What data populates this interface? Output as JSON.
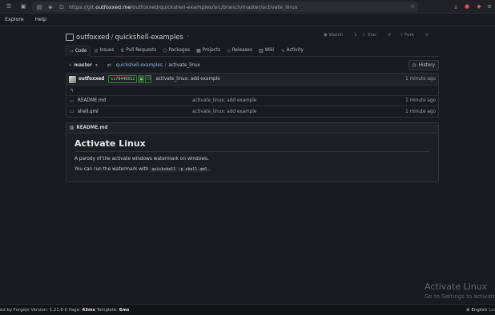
{
  "browser": {
    "url_prefix": "https://git.",
    "url_host": "outfoxxed.me",
    "url_path": "/outfoxxed/quickshell-examples/src/branch/master/activate_linux"
  },
  "topnav": {
    "explore": "Explore",
    "help": "Help"
  },
  "repo": {
    "owner": "outfoxxed",
    "separator": "/",
    "name": "quickshell-examples",
    "watch_label": "Watch",
    "watch_count": "1",
    "star_label": "Star",
    "star_count": "0",
    "fork_label": "Fork",
    "fork_count": "0"
  },
  "tabs": [
    {
      "label": "Code",
      "icon": "code-icon"
    },
    {
      "label": "Issues",
      "icon": "issue-icon"
    },
    {
      "label": "Pull Requests",
      "icon": "pull-request-icon"
    },
    {
      "label": "Packages",
      "icon": "package-icon"
    },
    {
      "label": "Projects",
      "icon": "project-icon"
    },
    {
      "label": "Releases",
      "icon": "tag-icon"
    },
    {
      "label": "Wiki",
      "icon": "book-icon"
    },
    {
      "label": "Activity",
      "icon": "pulse-icon"
    }
  ],
  "branch": {
    "name": "master",
    "crumb_repo": "quickshell-examples",
    "crumb_sep": "/",
    "crumb_dir": "activate_linux",
    "history_label": "History"
  },
  "commit": {
    "author": "outfoxxed",
    "sha": "cc78446012",
    "message": "activate_linux: add example",
    "time": "1 minute ago"
  },
  "files": [
    {
      "name": "README.md",
      "message": "activate_linux: add example",
      "time": "1 minute ago"
    },
    {
      "name": "shell.qml",
      "message": "activate_linux: add example",
      "time": "1 minute ago"
    }
  ],
  "readme": {
    "filename": "README.md",
    "title": "Activate Linux",
    "para1": "A parody of the activate windows watermark on windows.",
    "para2_prefix": "You can run the watermark with",
    "para2_code": "quickshell -p shell.qml",
    "para2_suffix": "."
  },
  "watermark": {
    "line1": "Activate Linux",
    "line2": "Go to Settings to activate"
  },
  "footer": {
    "prefix": "ed by Forgejo Version: 1.21.6-0 Page: ",
    "page_time": "43ms",
    "template_label": " Template: ",
    "template_time": "6ms",
    "language": "English",
    "trailing": "Lic"
  }
}
